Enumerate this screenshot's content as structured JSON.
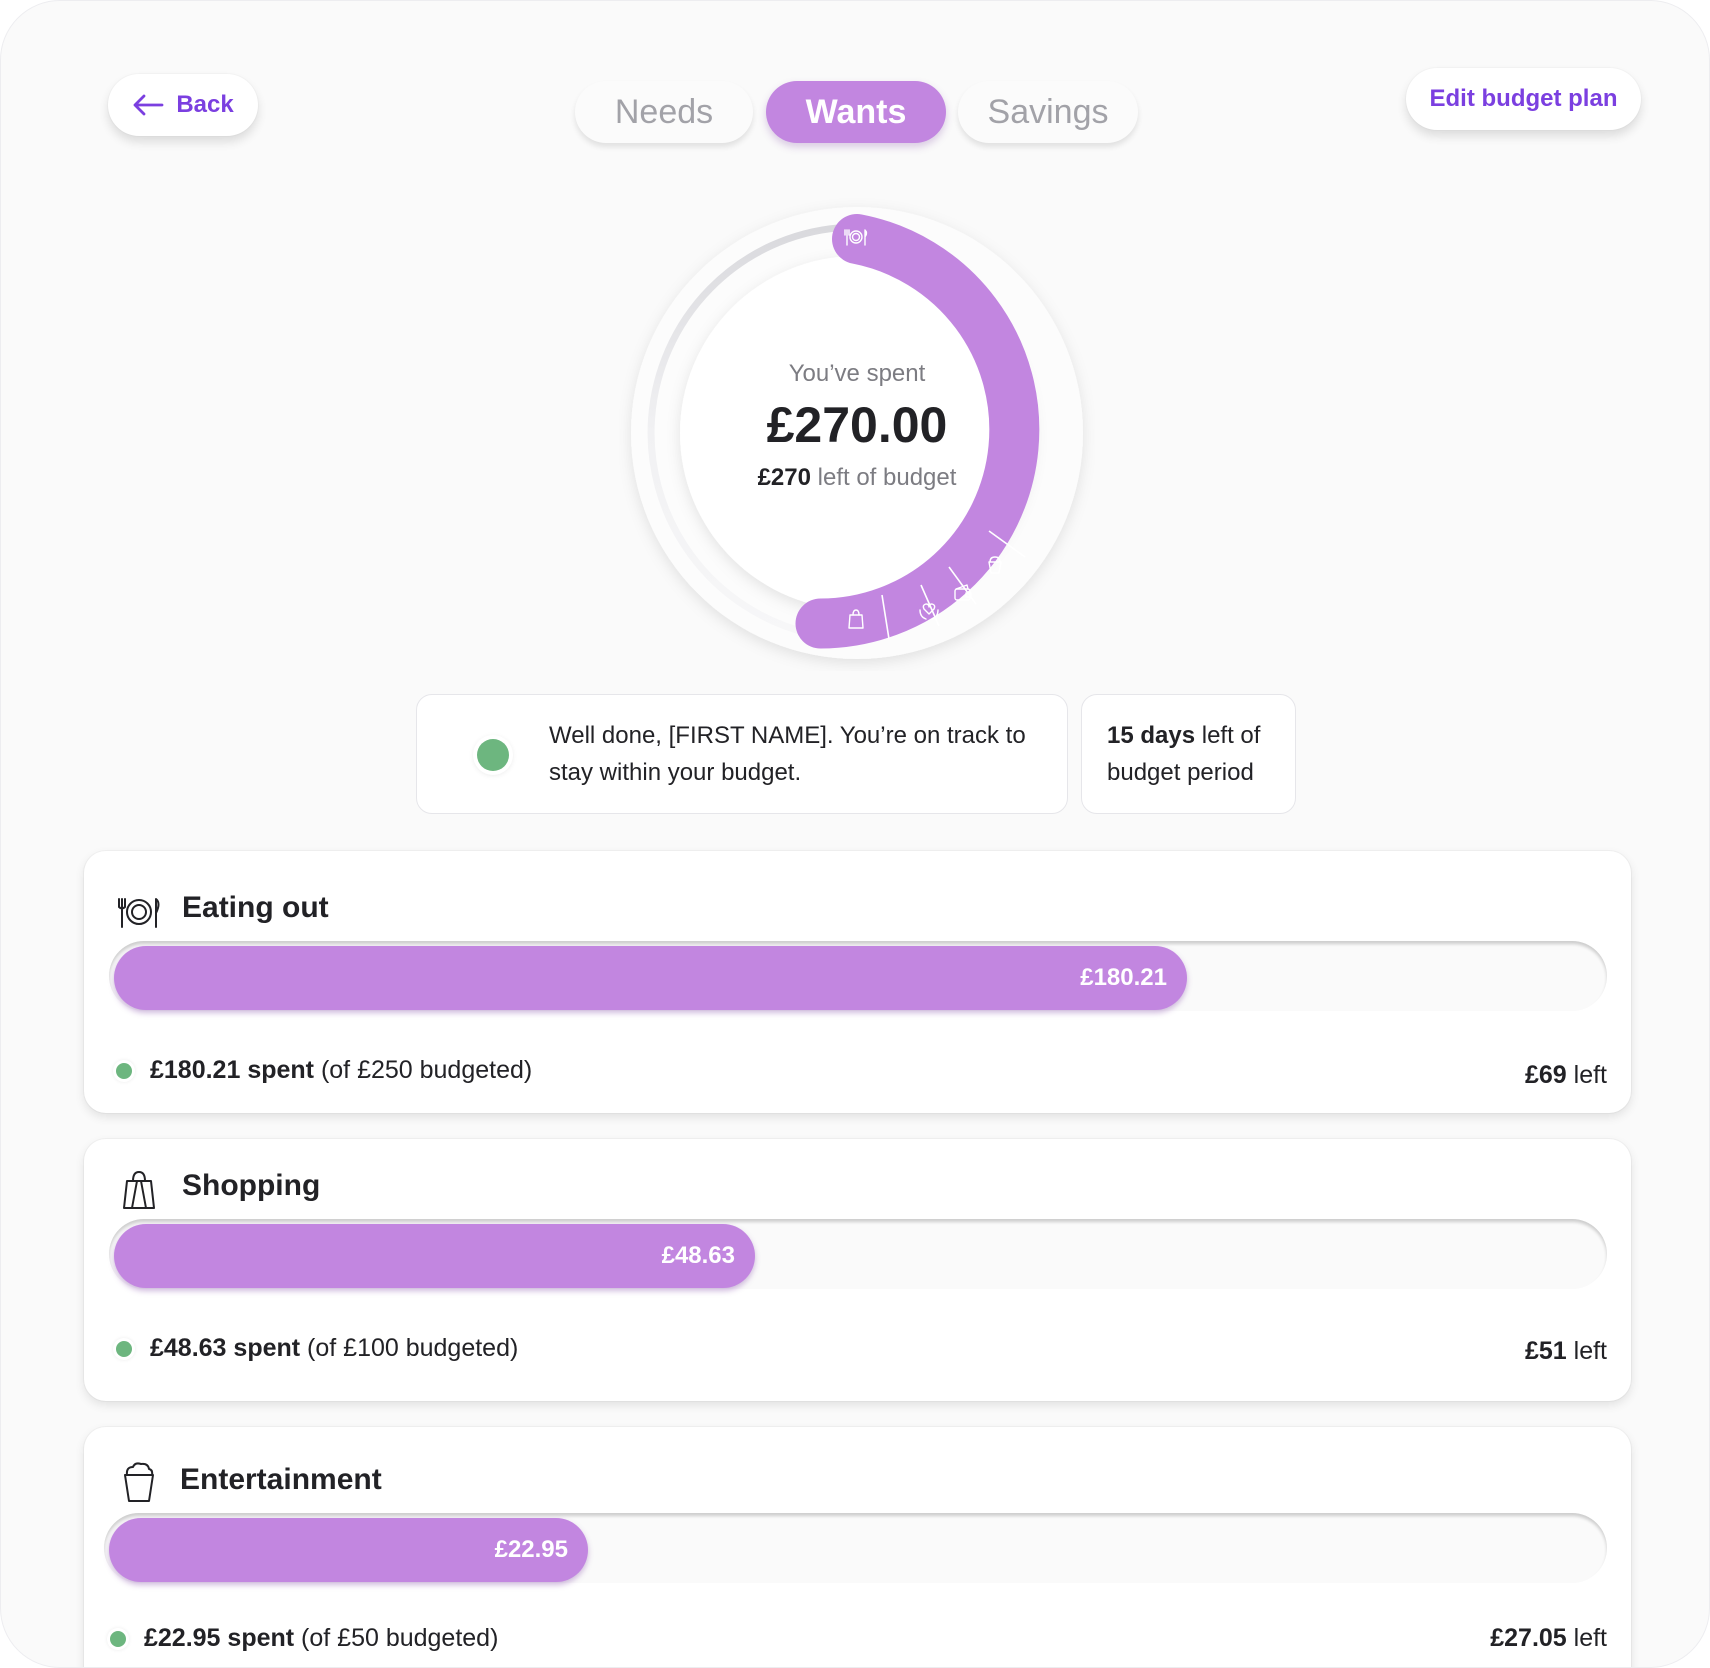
{
  "nav": {
    "back_label": "Back",
    "edit_label": "Edit budget plan",
    "tabs": [
      {
        "label": "Needs",
        "active": false
      },
      {
        "label": "Wants",
        "active": true
      },
      {
        "label": "Savings",
        "active": false
      }
    ]
  },
  "summary": {
    "spent_label": "You’ve spent",
    "spent_amount": "£270.00",
    "left_amount": "£270",
    "left_suffix": " left of budget",
    "segment_icons": [
      "cutlery-icon",
      "popcorn-icon",
      "wallet-icon",
      "heart-hands-icon",
      "shopping-bag-icon"
    ]
  },
  "status": {
    "message": "Well done, [FIRST NAME]. You’re on track to stay within your budget.",
    "days_bold": "15 days",
    "days_rest": " left of budget period"
  },
  "colors": {
    "accent": "#c286e0",
    "link": "#7b3fe0",
    "on_track": "#6db67f"
  },
  "categories": [
    {
      "icon": "cutlery-icon",
      "title": "Eating out",
      "bar_label": "£180.21",
      "progress_pct": 72.1,
      "spent": "£180.21 spent",
      "budget": " (of £250 budgeted)",
      "left_amount": "£69",
      "left_suffix": " left"
    },
    {
      "icon": "shopping-bag-icon",
      "title": "Shopping",
      "bar_label": "£48.63",
      "progress_pct": 43.1,
      "spent": "£48.63 spent",
      "budget": " (of £100 budgeted)",
      "left_amount": "£51",
      "left_suffix": " left"
    },
    {
      "icon": "popcorn-icon",
      "title": "Entertainment",
      "bar_label": "£22.95",
      "progress_pct": 32.1,
      "spent": "£22.95 spent",
      "budget": " (of £50 budgeted)",
      "left_amount": "£27.05",
      "left_suffix": " left"
    }
  ]
}
